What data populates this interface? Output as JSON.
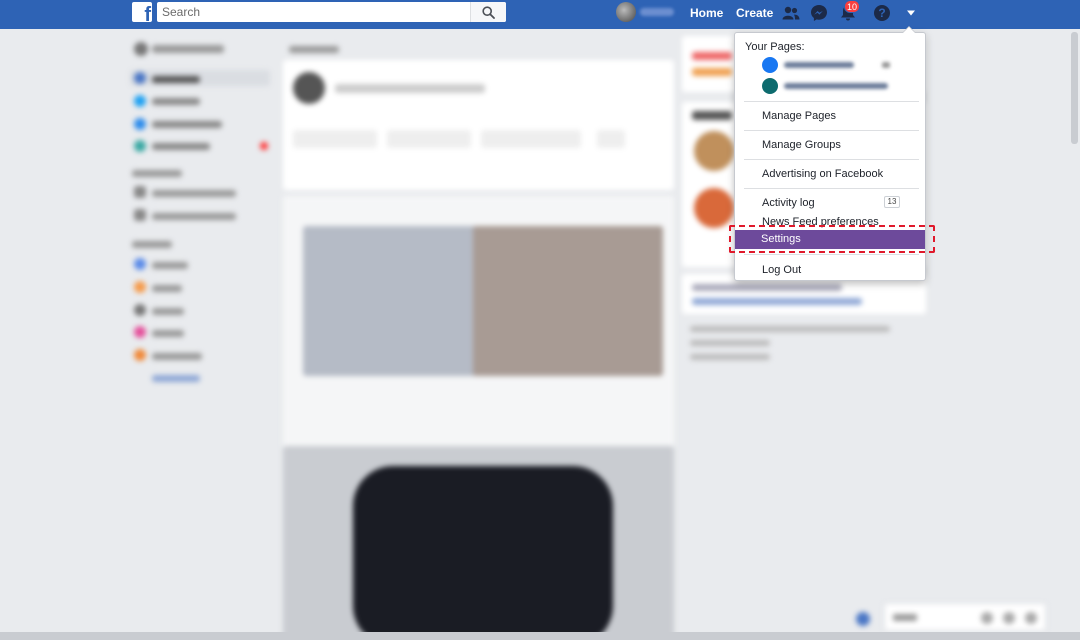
{
  "topbar": {
    "search_placeholder": "Search",
    "nav": {
      "home": "Home",
      "create": "Create"
    },
    "notification_count": "10"
  },
  "dropdown": {
    "header": "Your Pages:",
    "items": {
      "manage_pages": "Manage Pages",
      "manage_groups": "Manage Groups",
      "advertising": "Advertising on Facebook",
      "activity_log": "Activity log",
      "activity_count": "13",
      "news_feed_prefs": "News Feed preferences",
      "settings": "Settings",
      "log_out": "Log Out"
    }
  },
  "colors": {
    "topbar": "#2e63b5",
    "settings_highlight": "#6d4a9b",
    "annotation": "#e0192b"
  }
}
